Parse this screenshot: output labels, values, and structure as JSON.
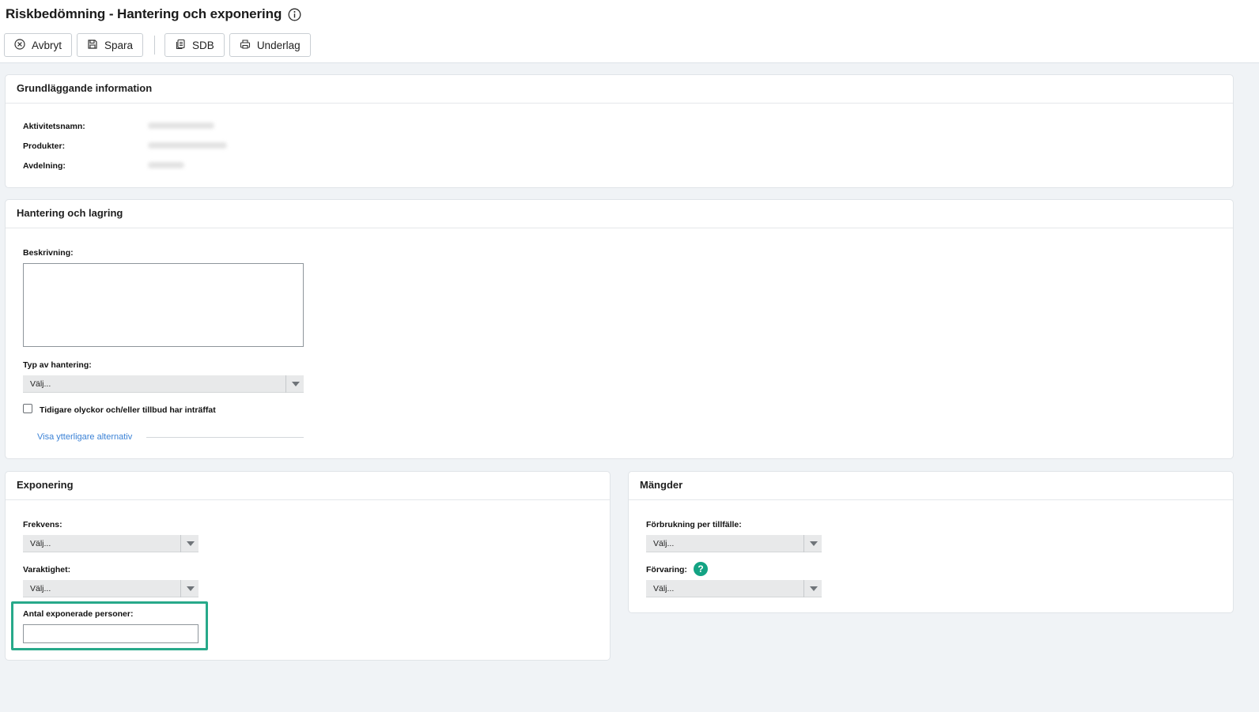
{
  "header": {
    "title": "Riskbedömning - Hantering och exponering"
  },
  "toolbar": {
    "cancel_label": "Avbryt",
    "save_label": "Spara",
    "sdb_label": "SDB",
    "underlag_label": "Underlag"
  },
  "basic_info": {
    "title": "Grundläggande information",
    "activity_label": "Aktivitetsnamn:",
    "products_label": "Produkter:",
    "department_label": "Avdelning:"
  },
  "handling": {
    "title": "Hantering och lagring",
    "description_label": "Beskrivning:",
    "handling_type_label": "Typ av hantering:",
    "handling_type_value": "Välj...",
    "accidents_checkbox_label": "Tidigare olyckor och/eller tillbud har inträffat",
    "accidents_checked": false,
    "more_options_link": "Visa ytterligare alternativ"
  },
  "exposure": {
    "title": "Exponering",
    "frequency_label": "Frekvens:",
    "frequency_value": "Välj...",
    "duration_label": "Varaktighet:",
    "duration_value": "Välj...",
    "exposed_persons_label": "Antal exponerade personer:",
    "exposed_persons_value": ""
  },
  "quantities": {
    "title": "Mängder",
    "consumption_label": "Förbrukning per tillfälle:",
    "consumption_value": "Välj...",
    "storage_label": "Förvaring:",
    "storage_value": "Välj...",
    "help_glyph": "?"
  },
  "colors": {
    "accent": "#13a383",
    "link": "#3b82d6",
    "highlight": "#27a98a"
  }
}
